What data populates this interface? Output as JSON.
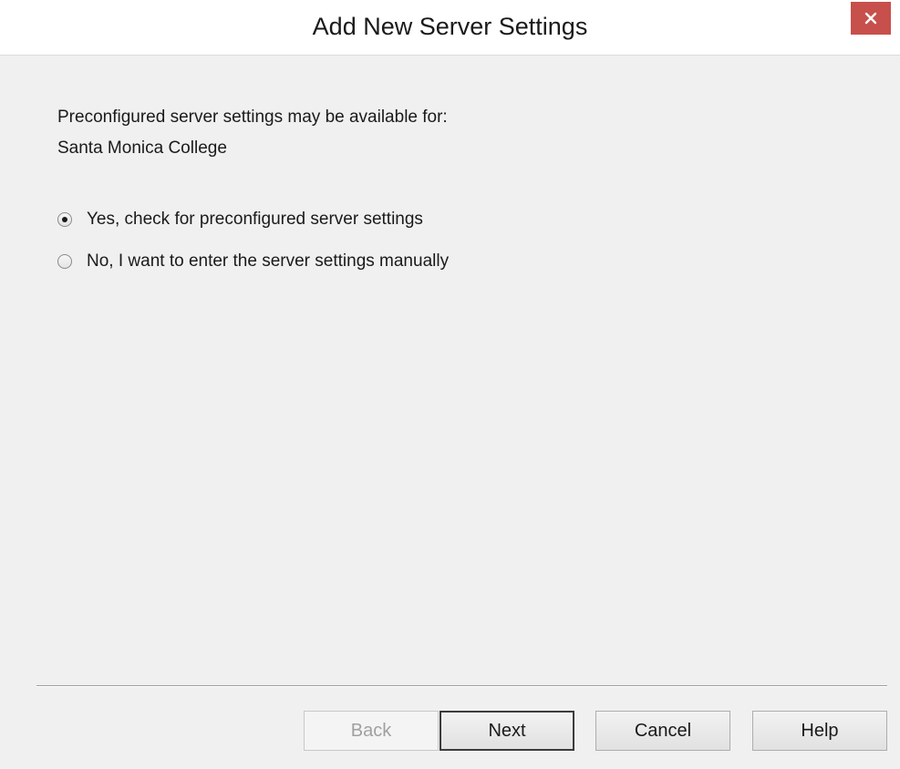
{
  "window": {
    "title": "Add New Server Settings",
    "close_icon": "close-icon",
    "close_color": "#c7504c"
  },
  "content": {
    "intro_text": "Preconfigured server settings may be available for:",
    "organization": "Santa Monica College"
  },
  "options": [
    {
      "label": "Yes, check for preconfigured server settings",
      "selected": true
    },
    {
      "label": "No, I want to enter the server settings manually",
      "selected": false
    }
  ],
  "buttons": {
    "back": {
      "label": "Back",
      "enabled": false
    },
    "next": {
      "label": "Next",
      "enabled": true,
      "default": true
    },
    "cancel": {
      "label": "Cancel",
      "enabled": true
    },
    "help": {
      "label": "Help",
      "enabled": true
    }
  }
}
